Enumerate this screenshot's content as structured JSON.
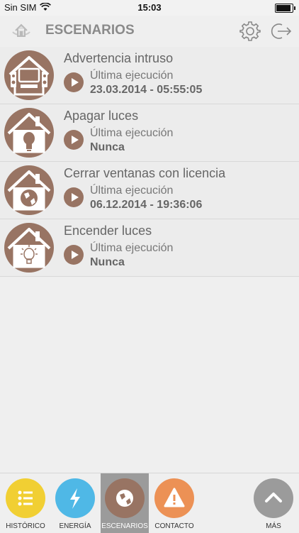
{
  "status_bar": {
    "carrier": "Sin SIM",
    "time": "15:03",
    "battery_level": 0.9
  },
  "header": {
    "title": "ESCENARIOS"
  },
  "scenarios": [
    {
      "name": "Advertencia intruso",
      "last_run_label": "Última ejecución",
      "last_run_value": "23.03.2014 - 05:55:05",
      "icon": "tv-house-icon"
    },
    {
      "name": "Apagar luces",
      "last_run_label": "Última ejecución",
      "last_run_value": "Nunca",
      "icon": "bulb-off-house-icon"
    },
    {
      "name": "Cerrar ventanas con licencia",
      "last_run_label": "Última ejecución",
      "last_run_value": "06.12.2014 - 19:36:06",
      "icon": "globe-house-icon"
    },
    {
      "name": "Encender luces",
      "last_run_label": "Última ejecución",
      "last_run_value": "Nunca",
      "icon": "bulb-on-house-icon"
    }
  ],
  "tabs": [
    {
      "label": "HISTÓRICO",
      "color": "#f1cf33",
      "icon": "list-icon"
    },
    {
      "label": "ENERGÍA",
      "color": "#4fb8e6",
      "icon": "lightning-icon"
    },
    {
      "label": "ESCENARIOS",
      "color": "#987463",
      "icon": "scenarios-icon",
      "active": true
    },
    {
      "label": "CONTACTO",
      "color": "#ec9155",
      "icon": "warning-icon"
    },
    {
      "label": "MÁS",
      "color": "#9b9b9b",
      "icon": "chevron-up-icon"
    }
  ],
  "colors": {
    "brown": "#987463",
    "background": "#efefef"
  }
}
